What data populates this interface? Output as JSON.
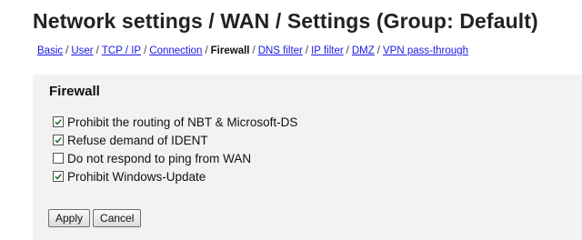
{
  "page": {
    "title": "Network settings / WAN / Settings (Group: Default)"
  },
  "breadcrumb": {
    "items": [
      {
        "label": "Basic",
        "current": false
      },
      {
        "label": "User",
        "current": false
      },
      {
        "label": "TCP / IP",
        "current": false
      },
      {
        "label": "Connection",
        "current": false
      },
      {
        "label": "Firewall",
        "current": true
      },
      {
        "label": "DNS filter",
        "current": false
      },
      {
        "label": "IP filter",
        "current": false
      },
      {
        "label": "DMZ",
        "current": false
      },
      {
        "label": "VPN pass-through",
        "current": false
      }
    ],
    "separator": "/"
  },
  "firewall": {
    "title": "Firewall",
    "options": [
      {
        "label": "Prohibit the routing of NBT & Microsoft-DS",
        "checked": true
      },
      {
        "label": "Refuse demand of IDENT",
        "checked": true
      },
      {
        "label": "Do not respond to ping from WAN",
        "checked": false
      },
      {
        "label": "Prohibit Windows-Update",
        "checked": true
      }
    ]
  },
  "buttons": {
    "apply_label": "Apply",
    "cancel_label": "Cancel"
  },
  "colors": {
    "link": "#1a1ae6",
    "panel_bg": "#f2f2f2",
    "check": "#2a6e2a"
  }
}
